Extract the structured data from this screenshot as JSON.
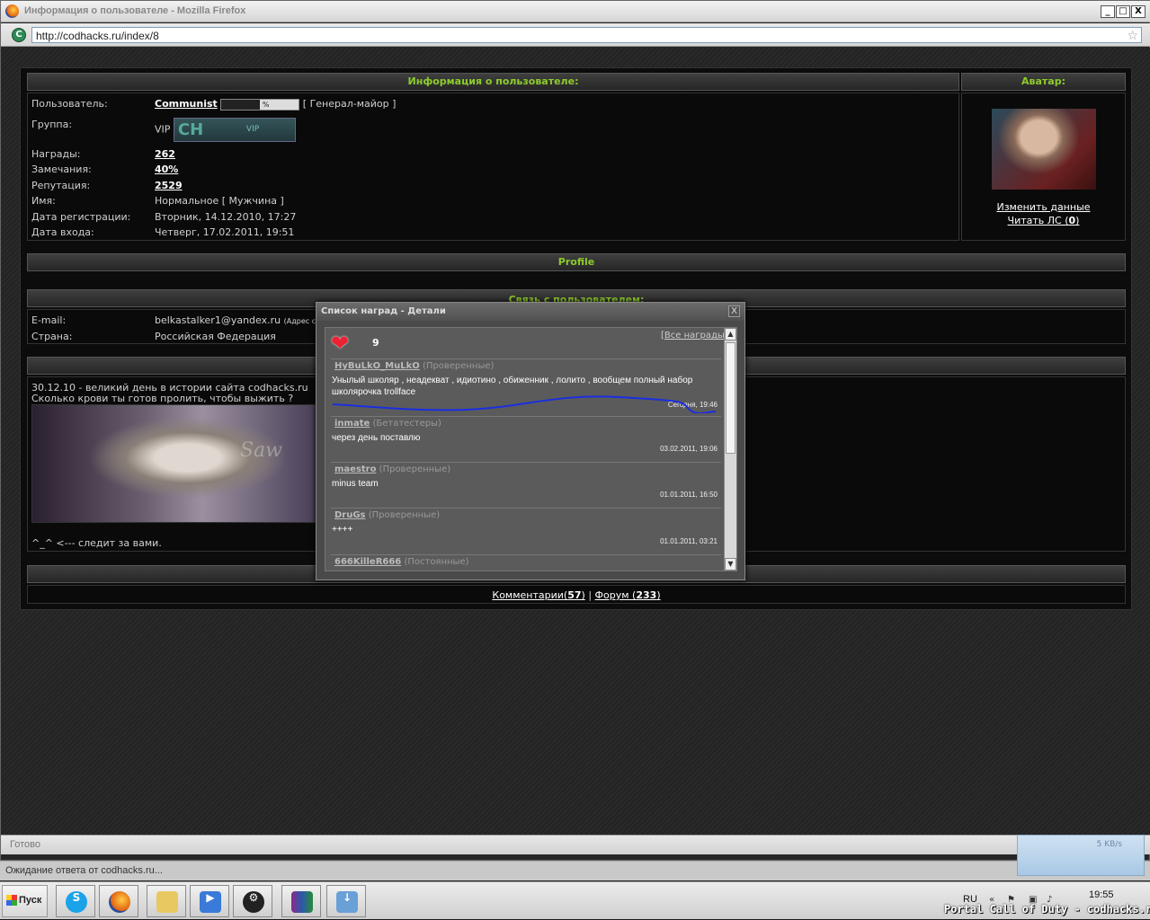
{
  "window": {
    "title": "Информация о пользователе - Mozilla Firefox",
    "min": "_",
    "max": "□",
    "close": "X"
  },
  "address": {
    "url": "http://codhacks.ru/index/8"
  },
  "info": {
    "header": "Информация о пользователе:",
    "avatar_header": "Аватар:",
    "user_label": "Пользователь:",
    "user_name": "Communist",
    "rank_pct": "10 %",
    "rank": "[ Генерал-майор ]",
    "group_label": "Группа:",
    "group": "VIP",
    "group_badge_letters": "CH",
    "group_badge_text": "VIP",
    "awards_label": "Награды:",
    "awards": "262",
    "warnings_label": "Замечания:",
    "warnings": "40%",
    "rep_label": "Репутация:",
    "rep": "2529",
    "name_label": "Имя:",
    "name": "Нормальное [ Мужчина ]",
    "reg_label": "Дата регистрации:",
    "reg": "Вторник, 14.12.2010, 17:27",
    "login_label": "Дата входа:",
    "login": "Четверг, 17.02.2011, 19:51",
    "edit_link": "Изменить данные",
    "pm_link_prefix": "Читать ЛС (",
    "pm_count": "0",
    "pm_link_suffix": ")"
  },
  "profile": {
    "header": "Profile"
  },
  "contact": {
    "header": "Связь с пользователем:",
    "email_label": "E-mail:",
    "email": "belkastalker1@yandex.ru",
    "email_note": "(Адрес с",
    "country_label": "Страна:",
    "country": "Российская Федерация"
  },
  "about": {
    "line1": "30.12.10 - великий день в истории сайта codhacks.ru",
    "line2": "Сколько крови ты готов пролить, чтобы выжить ?",
    "image_text": "Saw",
    "footer": "^_^ <--- следит за вами."
  },
  "footer": {
    "comments_label": "Комментарии",
    "comments_count": "57",
    "sep": "|",
    "forum_label": "Форум",
    "forum_count": "233"
  },
  "dialog": {
    "title": "Список наград - Детали",
    "close": "X",
    "count": "9",
    "all_link": "Все награды",
    "reviews": [
      {
        "user": "HyBuLkO_MuLkO",
        "group": "(Проверенные)",
        "text": "Унылый школяр , неадекват , идиотино , обиженник , лолито , вообщем полный набор школярочка trollface",
        "date": "Сегодня, 19:46"
      },
      {
        "user": "inmate",
        "group": "(Бетатестеры)",
        "text": "через день поставлю",
        "date": "03.02.2011, 19:06"
      },
      {
        "user": "maestro",
        "group": "(Проверенные)",
        "text": "minus team",
        "date": "01.01.2011, 16:50"
      },
      {
        "user": "DruGs",
        "group": "(Проверенные)",
        "text": "++++",
        "date": "01.01.2011, 03:21"
      },
      {
        "user": "666KilleR666",
        "group": "(Постоянные)",
        "text": "",
        "date": ""
      }
    ]
  },
  "statusbar": {
    "text": "Готово"
  },
  "loading": {
    "text": "Ожидание ответа от codhacks.ru..."
  },
  "netwidget": {
    "speed": "5 KB/s"
  },
  "taskbar": {
    "start": "Пуск",
    "lang": "RU",
    "clock": "19:55"
  },
  "watermark": "Portal Call of Duty - codhacks.ru"
}
